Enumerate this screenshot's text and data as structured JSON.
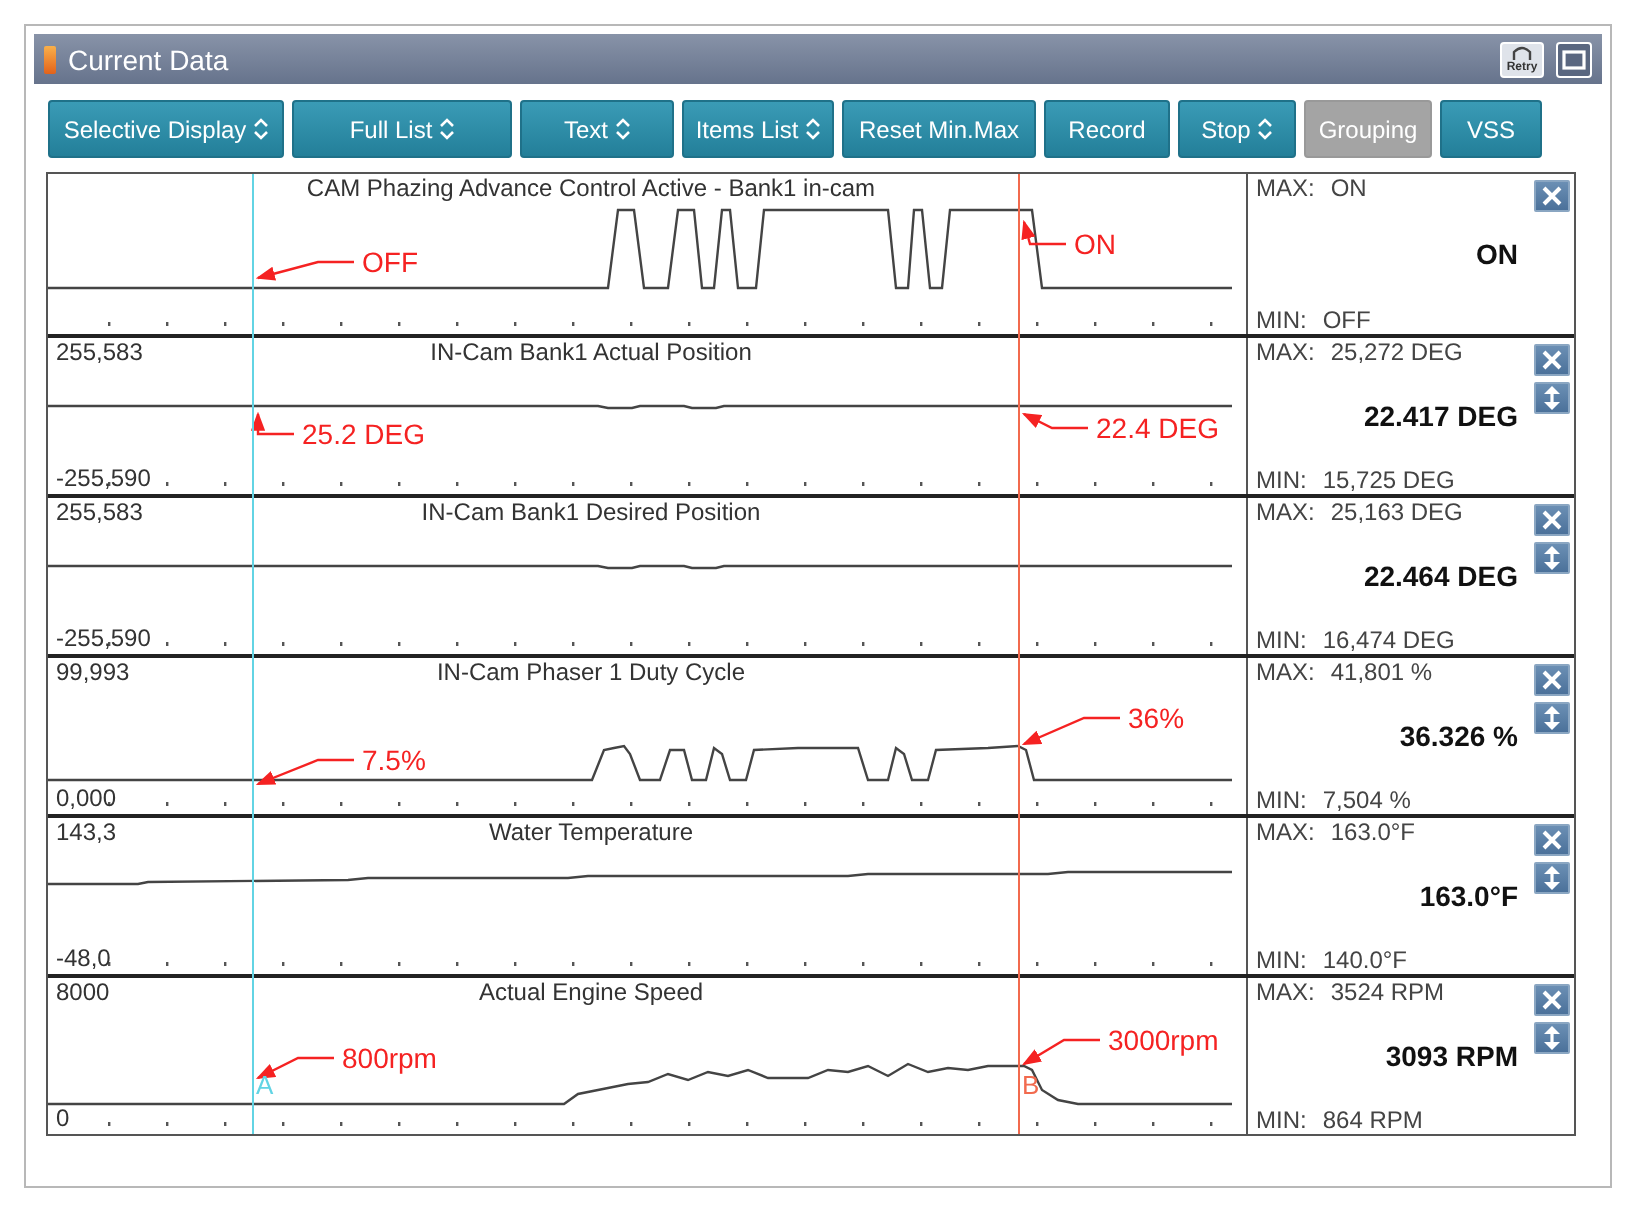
{
  "window": {
    "title": "Current Data",
    "retry_label": "Retry"
  },
  "toolbar": [
    {
      "label": "Selective Display",
      "dropdown": true,
      "disabled": false
    },
    {
      "label": "Full List",
      "dropdown": true,
      "disabled": false
    },
    {
      "label": "Text",
      "dropdown": true,
      "disabled": false
    },
    {
      "label": "Items List",
      "dropdown": true,
      "disabled": false
    },
    {
      "label": "Reset Min.Max",
      "dropdown": false,
      "disabled": false
    },
    {
      "label": "Record",
      "dropdown": false,
      "disabled": false
    },
    {
      "label": "Stop",
      "dropdown": true,
      "disabled": false
    },
    {
      "label": "Grouping",
      "dropdown": false,
      "disabled": true
    },
    {
      "label": "VSS",
      "dropdown": false,
      "disabled": false
    }
  ],
  "cursors": [
    {
      "label": "A",
      "color": "#62d4e4"
    },
    {
      "label": "B",
      "color": "#f26a4e"
    }
  ],
  "panels": [
    {
      "title": "CAM Phazing Advance Control Active - Bank1 in-cam",
      "kind": "digital",
      "max_label": "MAX:",
      "max": "ON",
      "current": "ON",
      "min_label": "MIN:",
      "min": "OFF",
      "movable": false,
      "annotations": [
        {
          "text": "OFF",
          "kind": "left"
        },
        {
          "text": "ON",
          "kind": "right"
        }
      ]
    },
    {
      "title": "IN-Cam Bank1 Actual Position",
      "scale_max": "255,583",
      "scale_min": "-255,590",
      "kind": "flat",
      "max_label": "MAX:",
      "max": "25,272 DEG",
      "current": "22.417 DEG",
      "min_label": "MIN:",
      "min": "15,725 DEG",
      "movable": true,
      "annotations": [
        {
          "text": "25.2 DEG",
          "kind": "left"
        },
        {
          "text": "22.4 DEG",
          "kind": "right"
        }
      ]
    },
    {
      "title": "IN-Cam Bank1 Desired Position",
      "scale_max": "255,583",
      "scale_min": "-255,590",
      "kind": "flat",
      "max_label": "MAX:",
      "max": "25,163 DEG",
      "current": "22.464 DEG",
      "min_label": "MIN:",
      "min": "16,474 DEG",
      "movable": true
    },
    {
      "title": "IN-Cam Phaser 1 Duty Cycle",
      "scale_max": "99,993",
      "scale_min": "0,000",
      "kind": "duty",
      "max_label": "MAX:",
      "max": "41,801 %",
      "current": "36.326 %",
      "min_label": "MIN:",
      "min": "7,504 %",
      "movable": true,
      "annotations": [
        {
          "text": "7.5%",
          "kind": "left"
        },
        {
          "text": "36%",
          "kind": "right"
        }
      ]
    },
    {
      "title": "Water Temperature",
      "scale_max": "143,3",
      "scale_min": "-48,0",
      "kind": "ramp",
      "max_label": "MAX:",
      "max": "163.0°F",
      "current": "163.0°F",
      "min_label": "MIN:",
      "min": "140.0°F",
      "movable": true
    },
    {
      "title": "Actual Engine Speed",
      "scale_max": "8000",
      "scale_min": "0",
      "kind": "rpm",
      "max_label": "MAX:",
      "max": "3524 RPM",
      "current": "3093 RPM",
      "min_label": "MIN:",
      "min": "864 RPM",
      "movable": true,
      "annotations": [
        {
          "text": "800rpm",
          "kind": "left"
        },
        {
          "text": "3000rpm",
          "kind": "right"
        }
      ]
    }
  ]
}
